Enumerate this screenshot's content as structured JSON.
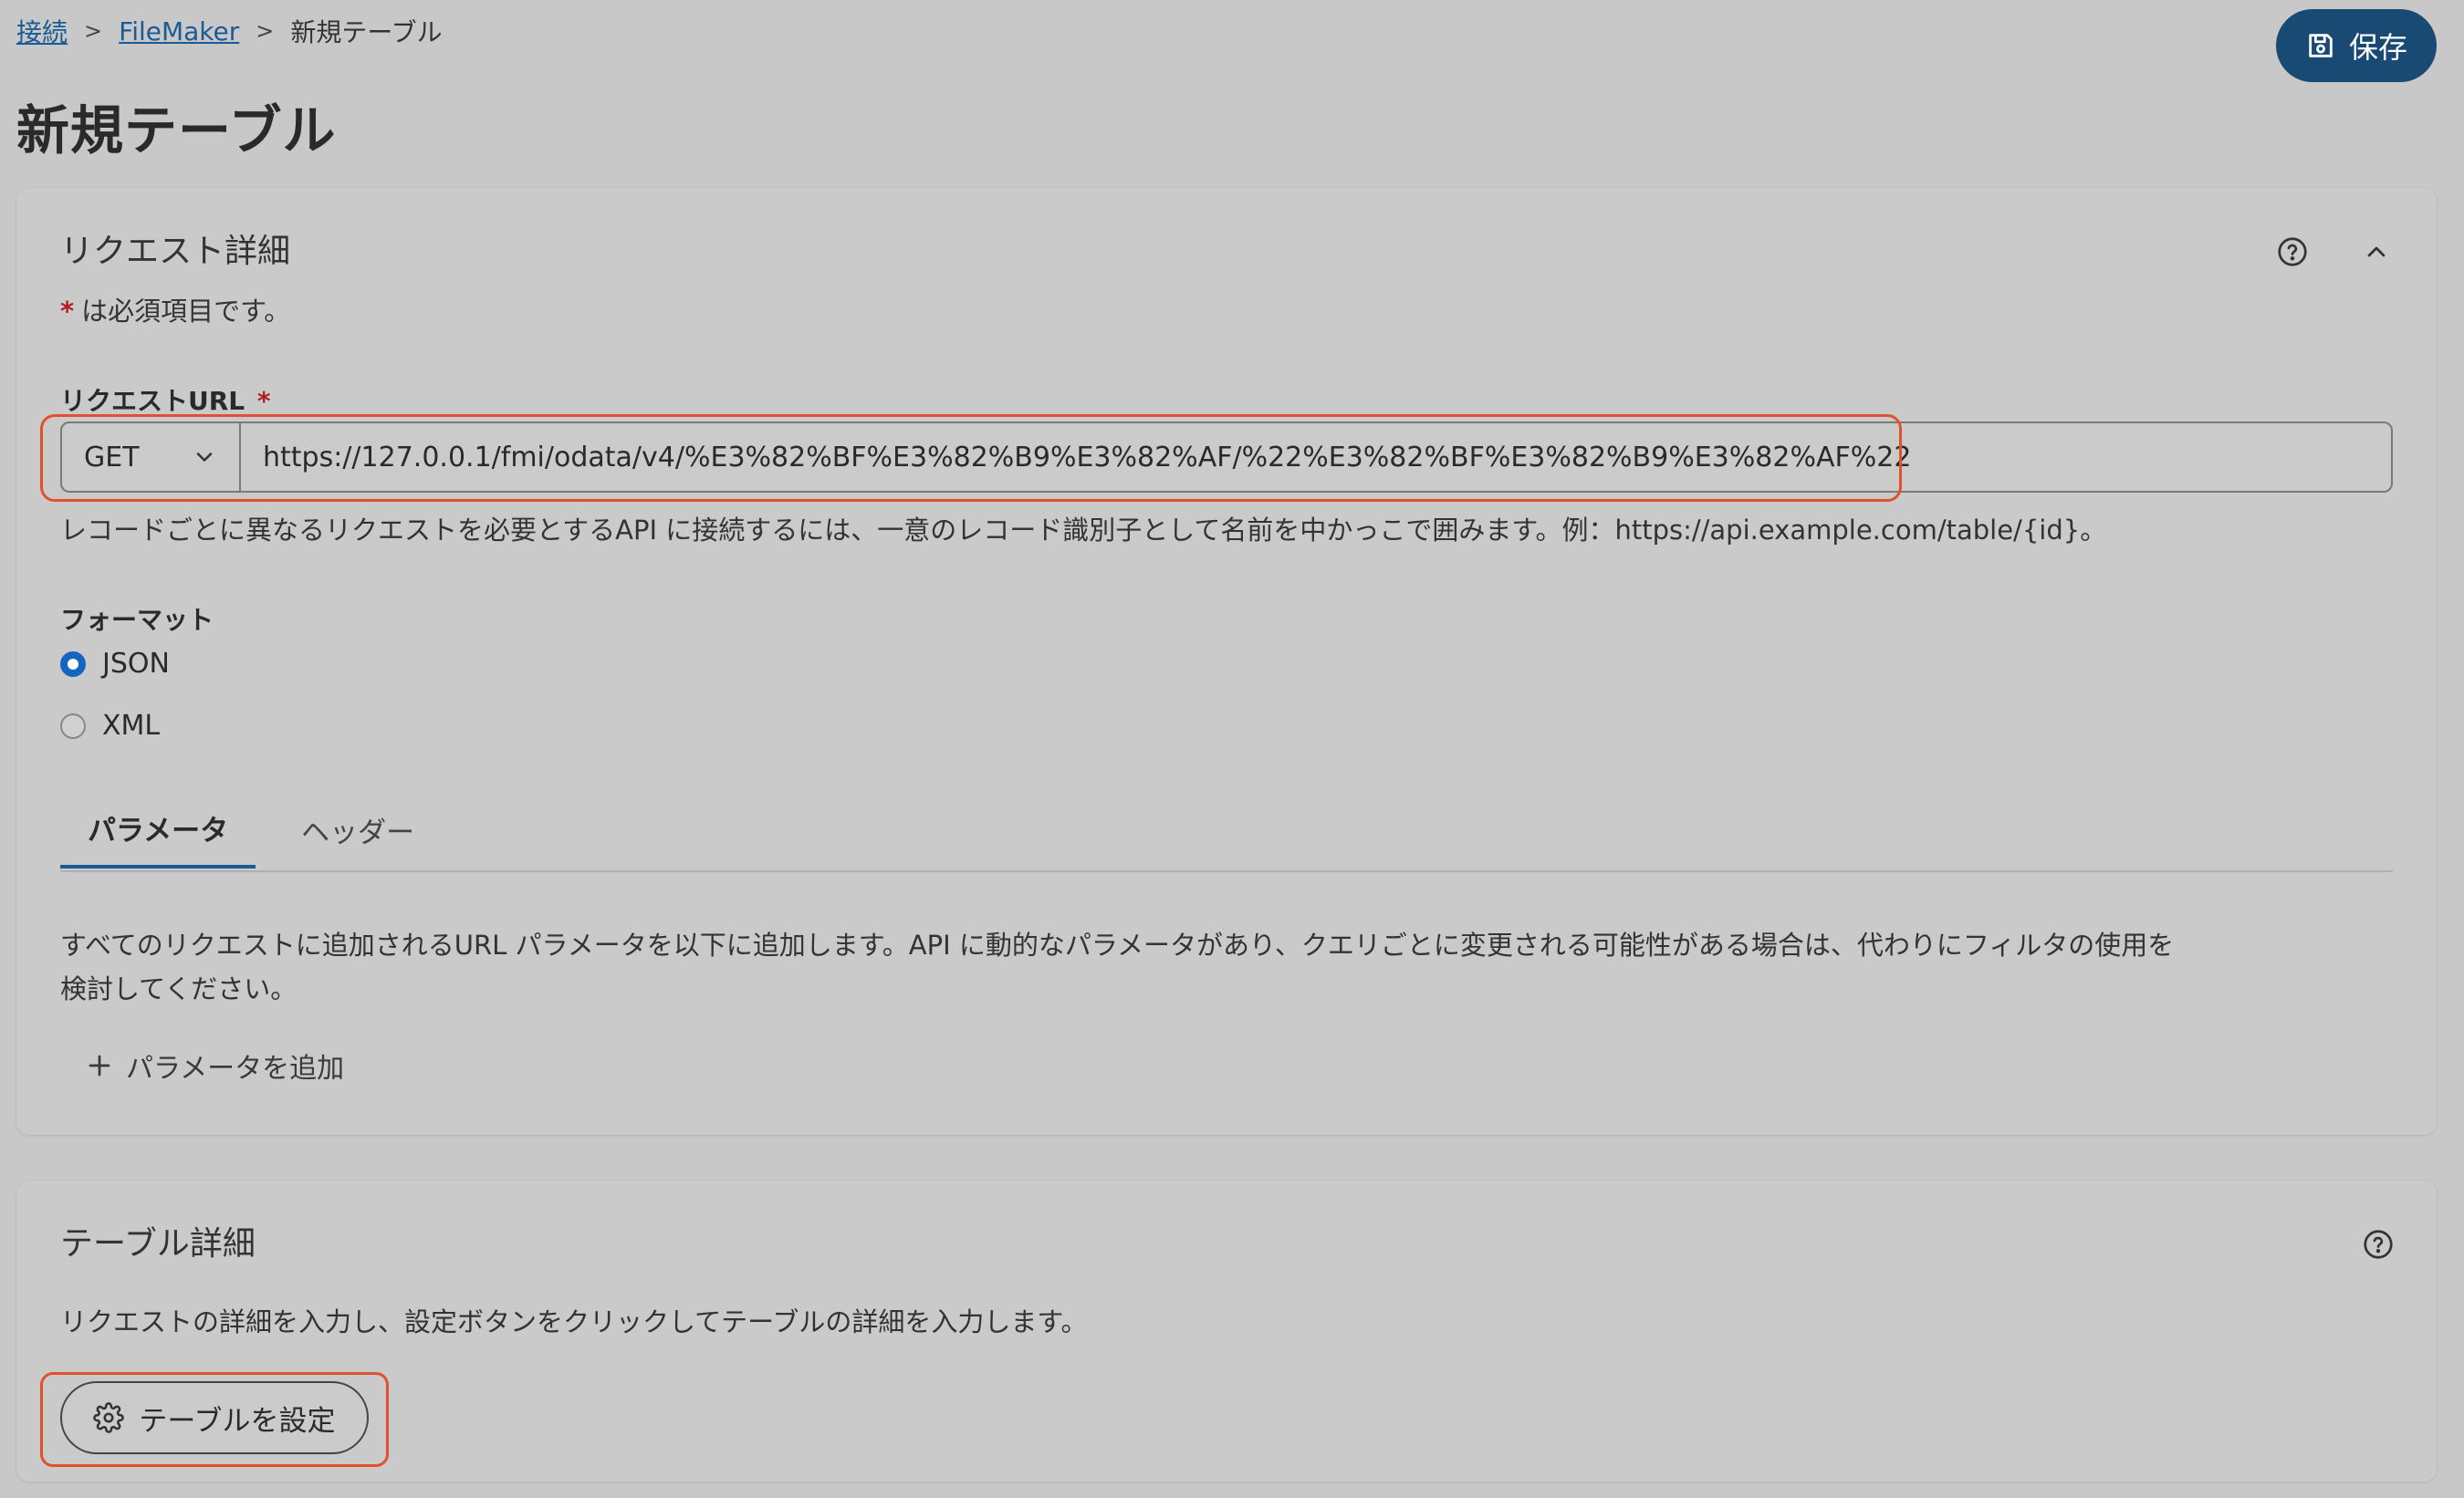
{
  "breadcrumb": {
    "items": [
      {
        "label": "接続"
      },
      {
        "label": "FileMaker"
      },
      {
        "label": "新規テーブル"
      }
    ],
    "separator": ">"
  },
  "page": {
    "title": "新規テーブル"
  },
  "toolbar": {
    "save_label": "保存"
  },
  "request_details": {
    "title": "リクエスト詳細",
    "required_star": "*",
    "required_note": "は必須項目です。",
    "url_label": "リクエストURL",
    "method": "GET",
    "url_value": "https://127.0.0.1/fmi/odata/v4/%E3%82%BF%E3%82%B9%E3%82%AF/%22%E3%82%BF%E3%82%B9%E3%82%AF%22",
    "url_help": "レコードごとに異なるリクエストを必要とするAPI に接続するには、一意のレコード識別子として名前を中かっこで囲みます。例：https://api.example.com/table/{id}。",
    "format_label": "フォーマット",
    "format_options": [
      {
        "label": "JSON",
        "checked": true
      },
      {
        "label": "XML",
        "checked": false
      }
    ],
    "tabs": [
      {
        "label": "パラメータ",
        "active": true
      },
      {
        "label": "ヘッダー",
        "active": false
      }
    ],
    "params_desc_line1": "すべてのリクエストに追加されるURL パラメータを以下に追加します。API に動的なパラメータがあり、クエリごとに変更される可能性がある場合は、代わりにフィルタの使用を",
    "params_desc_line2": "検討してください。",
    "add_param_label": "パラメータを追加"
  },
  "table_details": {
    "title": "テーブル詳細",
    "description": "リクエストの詳細を入力し、設定ボタンをクリックしてテーブルの詳細を入力します。",
    "configure_label": "テーブルを設定"
  },
  "colors": {
    "accent": "#184a73",
    "link": "#1a5a95",
    "highlight": "#e0522e",
    "radio_checked": "#1565c0",
    "required": "#b02020"
  },
  "icons": {
    "save": "save-icon",
    "help": "help-circle-icon",
    "collapse": "chevron-up-icon",
    "dropdown": "chevron-down-icon",
    "add": "plus-icon",
    "configure": "gear-icon"
  }
}
